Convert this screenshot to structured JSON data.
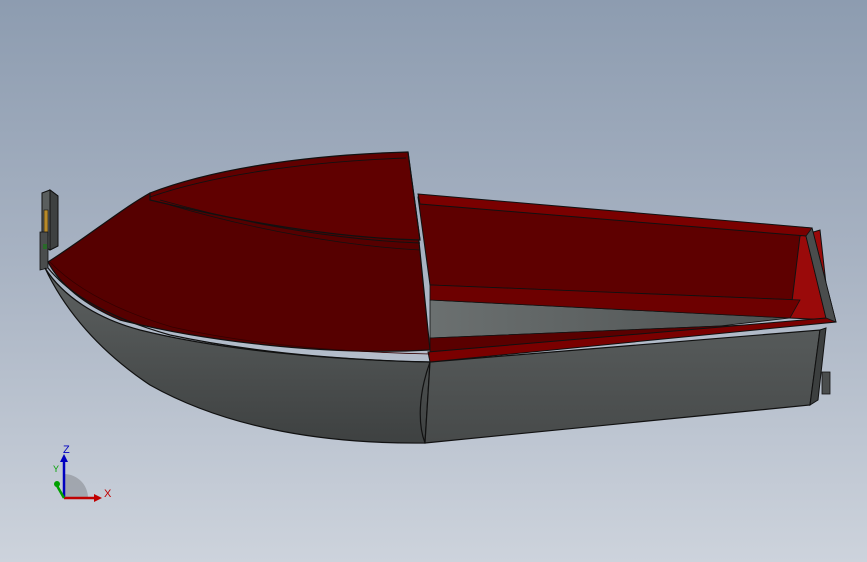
{
  "viewport": {
    "background_top": "#8d9cb0",
    "background_bottom": "#cdd3dc"
  },
  "model": {
    "hull_color": "#4f5252",
    "interior_color": "#5a0000",
    "interior_highlight": "#8a0a0a",
    "edge_color": "#0a0a0a"
  },
  "triad": {
    "x_label": "X",
    "y_label": "Y",
    "z_label": "Z",
    "x_color": "#c00000",
    "y_color": "#00a000",
    "z_color": "#0000c0"
  }
}
